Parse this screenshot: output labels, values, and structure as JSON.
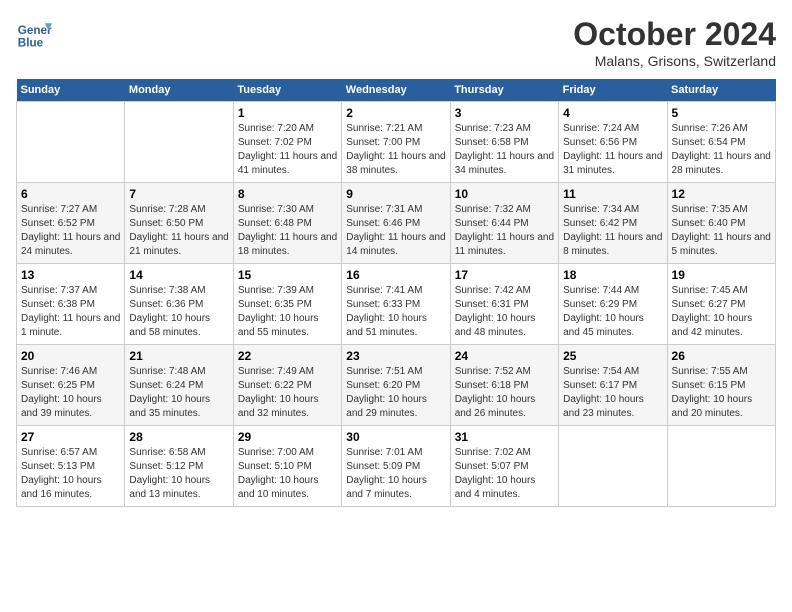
{
  "header": {
    "logo_line1": "General",
    "logo_line2": "Blue",
    "month": "October 2024",
    "location": "Malans, Grisons, Switzerland"
  },
  "weekdays": [
    "Sunday",
    "Monday",
    "Tuesday",
    "Wednesday",
    "Thursday",
    "Friday",
    "Saturday"
  ],
  "weeks": [
    [
      {
        "day": "",
        "empty": true
      },
      {
        "day": "",
        "empty": true
      },
      {
        "day": "1",
        "sunrise": "Sunrise: 7:20 AM",
        "sunset": "Sunset: 7:02 PM",
        "daylight": "Daylight: 11 hours and 41 minutes."
      },
      {
        "day": "2",
        "sunrise": "Sunrise: 7:21 AM",
        "sunset": "Sunset: 7:00 PM",
        "daylight": "Daylight: 11 hours and 38 minutes."
      },
      {
        "day": "3",
        "sunrise": "Sunrise: 7:23 AM",
        "sunset": "Sunset: 6:58 PM",
        "daylight": "Daylight: 11 hours and 34 minutes."
      },
      {
        "day": "4",
        "sunrise": "Sunrise: 7:24 AM",
        "sunset": "Sunset: 6:56 PM",
        "daylight": "Daylight: 11 hours and 31 minutes."
      },
      {
        "day": "5",
        "sunrise": "Sunrise: 7:26 AM",
        "sunset": "Sunset: 6:54 PM",
        "daylight": "Daylight: 11 hours and 28 minutes."
      }
    ],
    [
      {
        "day": "6",
        "sunrise": "Sunrise: 7:27 AM",
        "sunset": "Sunset: 6:52 PM",
        "daylight": "Daylight: 11 hours and 24 minutes."
      },
      {
        "day": "7",
        "sunrise": "Sunrise: 7:28 AM",
        "sunset": "Sunset: 6:50 PM",
        "daylight": "Daylight: 11 hours and 21 minutes."
      },
      {
        "day": "8",
        "sunrise": "Sunrise: 7:30 AM",
        "sunset": "Sunset: 6:48 PM",
        "daylight": "Daylight: 11 hours and 18 minutes."
      },
      {
        "day": "9",
        "sunrise": "Sunrise: 7:31 AM",
        "sunset": "Sunset: 6:46 PM",
        "daylight": "Daylight: 11 hours and 14 minutes."
      },
      {
        "day": "10",
        "sunrise": "Sunrise: 7:32 AM",
        "sunset": "Sunset: 6:44 PM",
        "daylight": "Daylight: 11 hours and 11 minutes."
      },
      {
        "day": "11",
        "sunrise": "Sunrise: 7:34 AM",
        "sunset": "Sunset: 6:42 PM",
        "daylight": "Daylight: 11 hours and 8 minutes."
      },
      {
        "day": "12",
        "sunrise": "Sunrise: 7:35 AM",
        "sunset": "Sunset: 6:40 PM",
        "daylight": "Daylight: 11 hours and 5 minutes."
      }
    ],
    [
      {
        "day": "13",
        "sunrise": "Sunrise: 7:37 AM",
        "sunset": "Sunset: 6:38 PM",
        "daylight": "Daylight: 11 hours and 1 minute."
      },
      {
        "day": "14",
        "sunrise": "Sunrise: 7:38 AM",
        "sunset": "Sunset: 6:36 PM",
        "daylight": "Daylight: 10 hours and 58 minutes."
      },
      {
        "day": "15",
        "sunrise": "Sunrise: 7:39 AM",
        "sunset": "Sunset: 6:35 PM",
        "daylight": "Daylight: 10 hours and 55 minutes."
      },
      {
        "day": "16",
        "sunrise": "Sunrise: 7:41 AM",
        "sunset": "Sunset: 6:33 PM",
        "daylight": "Daylight: 10 hours and 51 minutes."
      },
      {
        "day": "17",
        "sunrise": "Sunrise: 7:42 AM",
        "sunset": "Sunset: 6:31 PM",
        "daylight": "Daylight: 10 hours and 48 minutes."
      },
      {
        "day": "18",
        "sunrise": "Sunrise: 7:44 AM",
        "sunset": "Sunset: 6:29 PM",
        "daylight": "Daylight: 10 hours and 45 minutes."
      },
      {
        "day": "19",
        "sunrise": "Sunrise: 7:45 AM",
        "sunset": "Sunset: 6:27 PM",
        "daylight": "Daylight: 10 hours and 42 minutes."
      }
    ],
    [
      {
        "day": "20",
        "sunrise": "Sunrise: 7:46 AM",
        "sunset": "Sunset: 6:25 PM",
        "daylight": "Daylight: 10 hours and 39 minutes."
      },
      {
        "day": "21",
        "sunrise": "Sunrise: 7:48 AM",
        "sunset": "Sunset: 6:24 PM",
        "daylight": "Daylight: 10 hours and 35 minutes."
      },
      {
        "day": "22",
        "sunrise": "Sunrise: 7:49 AM",
        "sunset": "Sunset: 6:22 PM",
        "daylight": "Daylight: 10 hours and 32 minutes."
      },
      {
        "day": "23",
        "sunrise": "Sunrise: 7:51 AM",
        "sunset": "Sunset: 6:20 PM",
        "daylight": "Daylight: 10 hours and 29 minutes."
      },
      {
        "day": "24",
        "sunrise": "Sunrise: 7:52 AM",
        "sunset": "Sunset: 6:18 PM",
        "daylight": "Daylight: 10 hours and 26 minutes."
      },
      {
        "day": "25",
        "sunrise": "Sunrise: 7:54 AM",
        "sunset": "Sunset: 6:17 PM",
        "daylight": "Daylight: 10 hours and 23 minutes."
      },
      {
        "day": "26",
        "sunrise": "Sunrise: 7:55 AM",
        "sunset": "Sunset: 6:15 PM",
        "daylight": "Daylight: 10 hours and 20 minutes."
      }
    ],
    [
      {
        "day": "27",
        "sunrise": "Sunrise: 6:57 AM",
        "sunset": "Sunset: 5:13 PM",
        "daylight": "Daylight: 10 hours and 16 minutes."
      },
      {
        "day": "28",
        "sunrise": "Sunrise: 6:58 AM",
        "sunset": "Sunset: 5:12 PM",
        "daylight": "Daylight: 10 hours and 13 minutes."
      },
      {
        "day": "29",
        "sunrise": "Sunrise: 7:00 AM",
        "sunset": "Sunset: 5:10 PM",
        "daylight": "Daylight: 10 hours and 10 minutes."
      },
      {
        "day": "30",
        "sunrise": "Sunrise: 7:01 AM",
        "sunset": "Sunset: 5:09 PM",
        "daylight": "Daylight: 10 hours and 7 minutes."
      },
      {
        "day": "31",
        "sunrise": "Sunrise: 7:02 AM",
        "sunset": "Sunset: 5:07 PM",
        "daylight": "Daylight: 10 hours and 4 minutes."
      },
      {
        "day": "",
        "empty": true
      },
      {
        "day": "",
        "empty": true
      }
    ]
  ]
}
